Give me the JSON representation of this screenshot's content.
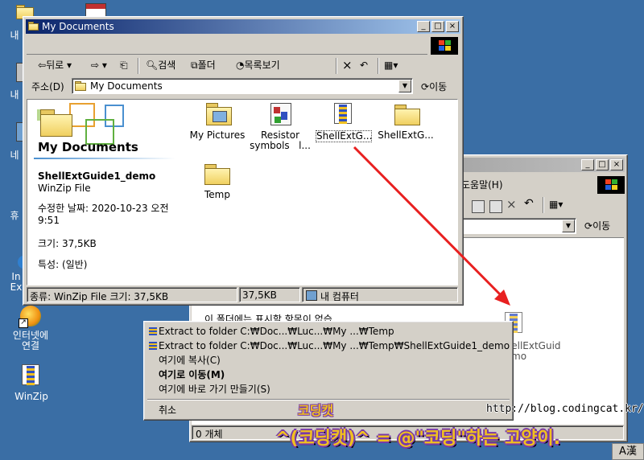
{
  "desktop": {
    "icons": [
      {
        "label": "내"
      },
      {
        "label": "내"
      },
      {
        "label": "네"
      },
      {
        "label": "휴"
      },
      {
        "label": "In\nEx"
      },
      {
        "label": "인터넷에\n연결"
      },
      {
        "label": "WinZip"
      }
    ]
  },
  "front_window": {
    "title": "My Documents",
    "toolbar": {
      "back": "뒤로",
      "search": "검색",
      "folders": "폴더",
      "views": "목록보기"
    },
    "address": {
      "label": "주소(D)",
      "value": "My Documents",
      "go": "이동"
    },
    "left_panel": {
      "heading": "My Documents",
      "file_name": "ShellExtGuide1_demo",
      "file_type": "WinZip File",
      "modified": "수정한 날짜: 2020-10-23 오전 9:51",
      "size": "크기: 37,5KB",
      "attributes": "특성: (일반)"
    },
    "items": [
      {
        "label": "My Pictures"
      },
      {
        "label": "Resistor\nsymbols   l..."
      },
      {
        "label": "ShellExtG..."
      },
      {
        "label": "ShellExtG..."
      },
      {
        "label": "Temp"
      }
    ],
    "status": {
      "info": "종류: WinZip File 크기: 37,5KB",
      "size": "37,5KB",
      "zone": "내 컴퓨터"
    }
  },
  "back_window": {
    "menu_help": "도움말(H)",
    "go": "이동",
    "empty_message": "이 폴더에는 표시할 항목이 없습",
    "dropped_item": "ShellExtGuid\ndemo",
    "status": "0 개체"
  },
  "context_menu": {
    "items": [
      {
        "label": "Extract to folder C:₩Doc...₩Luc...₩My ...₩Temp",
        "bold": false
      },
      {
        "label": "Extract to folder C:₩Doc...₩Luc...₩My ...₩Temp₩ShellExtGuide1_demo",
        "bold": false
      },
      {
        "label": "여기에 복사(C)",
        "bold": false
      },
      {
        "label": "여기로 이동(M)",
        "bold": true
      },
      {
        "label": "여기에 바로 가기 만들기(S)",
        "bold": false
      },
      {
        "label": "취소",
        "bold": false
      }
    ]
  },
  "watermark": {
    "blog_url": "http://blog.codingcat.kr/",
    "logo_text": "코딩캣",
    "tagline": "^(코딩캣)^ = @\"코딩\"하는 고양이."
  },
  "ime_indicator": "A漢",
  "colors": {
    "desktop": "#3a6ea5",
    "title_active": "#0a246a",
    "arrow": "#e82020",
    "logo_yellow": "#f0c020",
    "logo_purple": "#7a3aa8"
  }
}
